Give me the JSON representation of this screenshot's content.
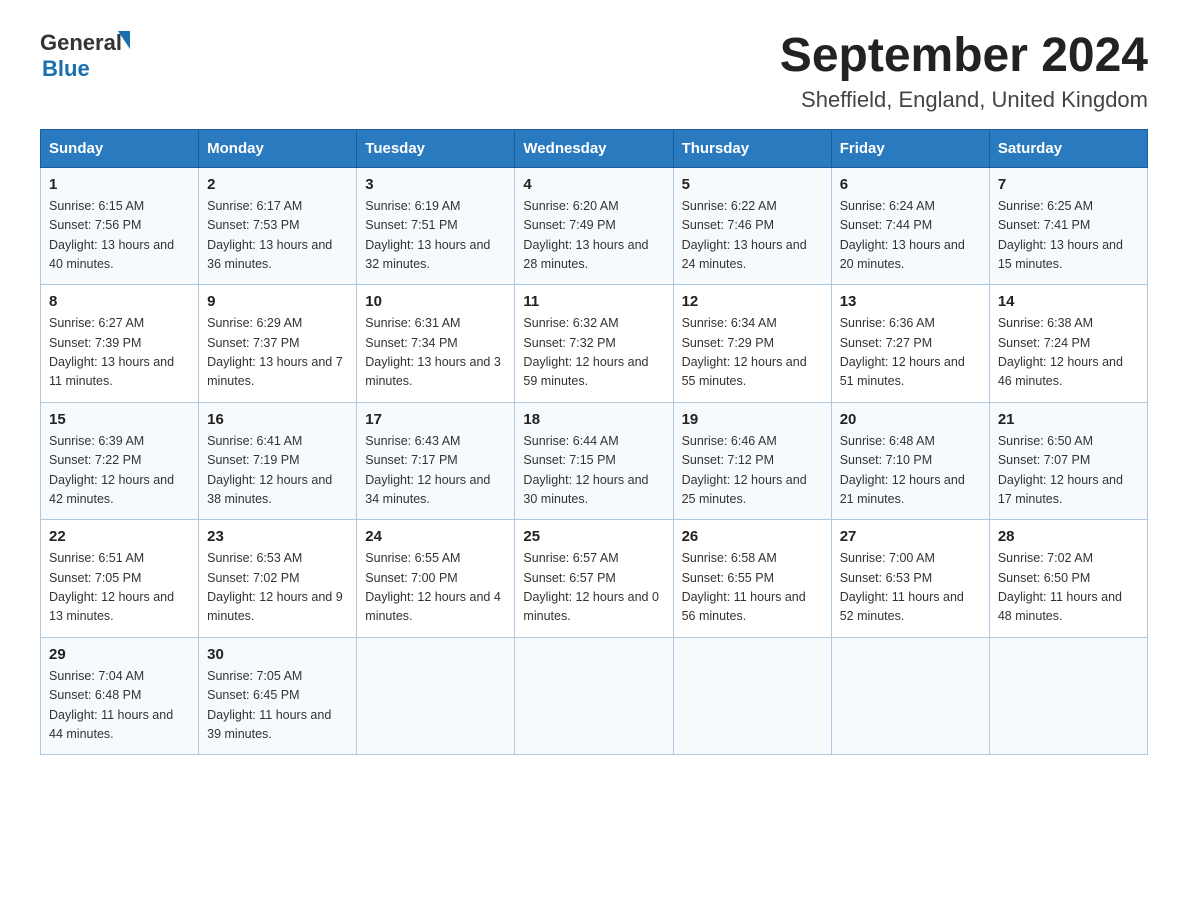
{
  "header": {
    "logo_general": "General",
    "logo_triangle": "▶",
    "logo_blue": "Blue",
    "month_title": "September 2024",
    "location": "Sheffield, England, United Kingdom"
  },
  "weekdays": [
    "Sunday",
    "Monday",
    "Tuesday",
    "Wednesday",
    "Thursday",
    "Friday",
    "Saturday"
  ],
  "weeks": [
    [
      {
        "day": "1",
        "sunrise": "6:15 AM",
        "sunset": "7:56 PM",
        "daylight": "13 hours and 40 minutes."
      },
      {
        "day": "2",
        "sunrise": "6:17 AM",
        "sunset": "7:53 PM",
        "daylight": "13 hours and 36 minutes."
      },
      {
        "day": "3",
        "sunrise": "6:19 AM",
        "sunset": "7:51 PM",
        "daylight": "13 hours and 32 minutes."
      },
      {
        "day": "4",
        "sunrise": "6:20 AM",
        "sunset": "7:49 PM",
        "daylight": "13 hours and 28 minutes."
      },
      {
        "day": "5",
        "sunrise": "6:22 AM",
        "sunset": "7:46 PM",
        "daylight": "13 hours and 24 minutes."
      },
      {
        "day": "6",
        "sunrise": "6:24 AM",
        "sunset": "7:44 PM",
        "daylight": "13 hours and 20 minutes."
      },
      {
        "day": "7",
        "sunrise": "6:25 AM",
        "sunset": "7:41 PM",
        "daylight": "13 hours and 15 minutes."
      }
    ],
    [
      {
        "day": "8",
        "sunrise": "6:27 AM",
        "sunset": "7:39 PM",
        "daylight": "13 hours and 11 minutes."
      },
      {
        "day": "9",
        "sunrise": "6:29 AM",
        "sunset": "7:37 PM",
        "daylight": "13 hours and 7 minutes."
      },
      {
        "day": "10",
        "sunrise": "6:31 AM",
        "sunset": "7:34 PM",
        "daylight": "13 hours and 3 minutes."
      },
      {
        "day": "11",
        "sunrise": "6:32 AM",
        "sunset": "7:32 PM",
        "daylight": "12 hours and 59 minutes."
      },
      {
        "day": "12",
        "sunrise": "6:34 AM",
        "sunset": "7:29 PM",
        "daylight": "12 hours and 55 minutes."
      },
      {
        "day": "13",
        "sunrise": "6:36 AM",
        "sunset": "7:27 PM",
        "daylight": "12 hours and 51 minutes."
      },
      {
        "day": "14",
        "sunrise": "6:38 AM",
        "sunset": "7:24 PM",
        "daylight": "12 hours and 46 minutes."
      }
    ],
    [
      {
        "day": "15",
        "sunrise": "6:39 AM",
        "sunset": "7:22 PM",
        "daylight": "12 hours and 42 minutes."
      },
      {
        "day": "16",
        "sunrise": "6:41 AM",
        "sunset": "7:19 PM",
        "daylight": "12 hours and 38 minutes."
      },
      {
        "day": "17",
        "sunrise": "6:43 AM",
        "sunset": "7:17 PM",
        "daylight": "12 hours and 34 minutes."
      },
      {
        "day": "18",
        "sunrise": "6:44 AM",
        "sunset": "7:15 PM",
        "daylight": "12 hours and 30 minutes."
      },
      {
        "day": "19",
        "sunrise": "6:46 AM",
        "sunset": "7:12 PM",
        "daylight": "12 hours and 25 minutes."
      },
      {
        "day": "20",
        "sunrise": "6:48 AM",
        "sunset": "7:10 PM",
        "daylight": "12 hours and 21 minutes."
      },
      {
        "day": "21",
        "sunrise": "6:50 AM",
        "sunset": "7:07 PM",
        "daylight": "12 hours and 17 minutes."
      }
    ],
    [
      {
        "day": "22",
        "sunrise": "6:51 AM",
        "sunset": "7:05 PM",
        "daylight": "12 hours and 13 minutes."
      },
      {
        "day": "23",
        "sunrise": "6:53 AM",
        "sunset": "7:02 PM",
        "daylight": "12 hours and 9 minutes."
      },
      {
        "day": "24",
        "sunrise": "6:55 AM",
        "sunset": "7:00 PM",
        "daylight": "12 hours and 4 minutes."
      },
      {
        "day": "25",
        "sunrise": "6:57 AM",
        "sunset": "6:57 PM",
        "daylight": "12 hours and 0 minutes."
      },
      {
        "day": "26",
        "sunrise": "6:58 AM",
        "sunset": "6:55 PM",
        "daylight": "11 hours and 56 minutes."
      },
      {
        "day": "27",
        "sunrise": "7:00 AM",
        "sunset": "6:53 PM",
        "daylight": "11 hours and 52 minutes."
      },
      {
        "day": "28",
        "sunrise": "7:02 AM",
        "sunset": "6:50 PM",
        "daylight": "11 hours and 48 minutes."
      }
    ],
    [
      {
        "day": "29",
        "sunrise": "7:04 AM",
        "sunset": "6:48 PM",
        "daylight": "11 hours and 44 minutes."
      },
      {
        "day": "30",
        "sunrise": "7:05 AM",
        "sunset": "6:45 PM",
        "daylight": "11 hours and 39 minutes."
      },
      null,
      null,
      null,
      null,
      null
    ]
  ]
}
